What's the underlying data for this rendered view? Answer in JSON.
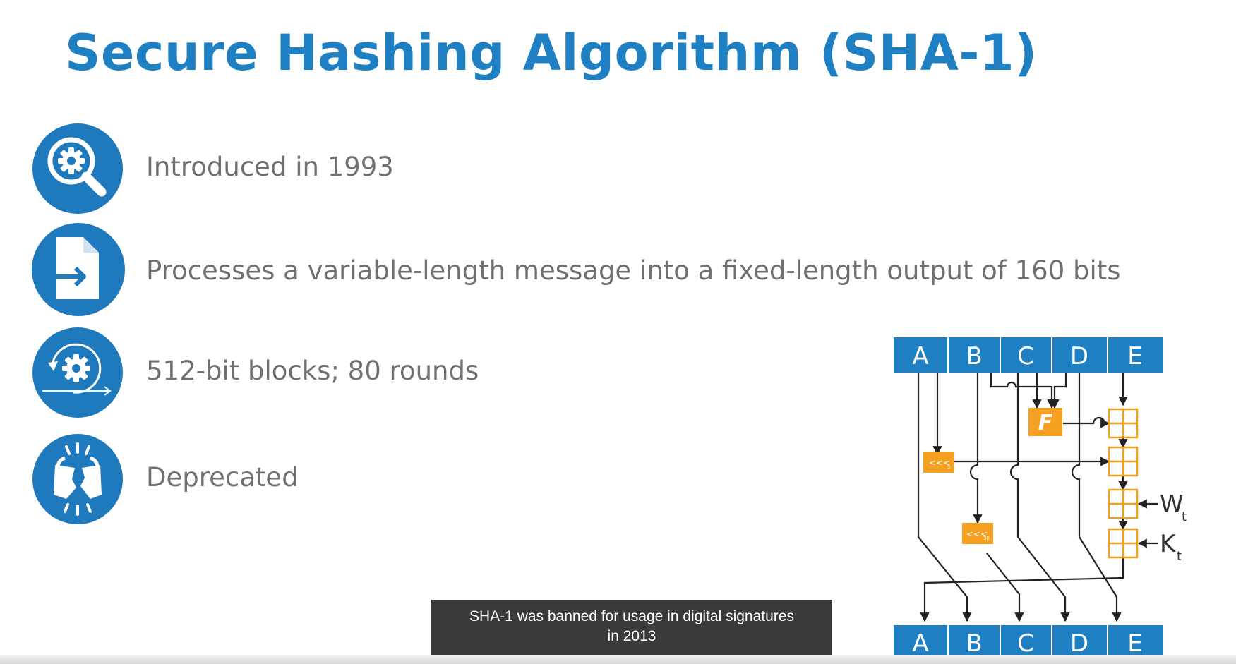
{
  "slide": {
    "title": "Secure Hashing Algorithm (SHA-1)",
    "bullets": [
      {
        "icon": "magnifier-gear-icon",
        "text": "Introduced in 1993"
      },
      {
        "icon": "document-arrow-icon",
        "text": "Processes a variable-length message into a fixed-length output of 160 bits"
      },
      {
        "icon": "gear-cycle-icon",
        "text": "512-bit blocks; 80 rounds"
      },
      {
        "icon": "broken-icon",
        "text": "Deprecated"
      }
    ],
    "caption_lines": [
      "SHA-1 was banned for usage in digital signatures",
      "in 2013"
    ]
  },
  "diagram": {
    "registers_top": [
      "A",
      "B",
      "C",
      "D",
      "E"
    ],
    "registers_bottom": [
      "A",
      "B",
      "C",
      "D",
      "E"
    ],
    "function_label": "F",
    "rotate_left_5": {
      "op": "<<<",
      "n": "5"
    },
    "rotate_left_30": {
      "op": "<<<",
      "n": "30"
    },
    "w_input": {
      "letter": "W",
      "sub": "t"
    },
    "k_input": {
      "letter": "K",
      "sub": "t"
    },
    "colors": {
      "register": "#1e7fc2",
      "operation": "#f5a020",
      "adder": "#f0a020",
      "line": "#222222",
      "title": "#1e7fc2"
    }
  }
}
